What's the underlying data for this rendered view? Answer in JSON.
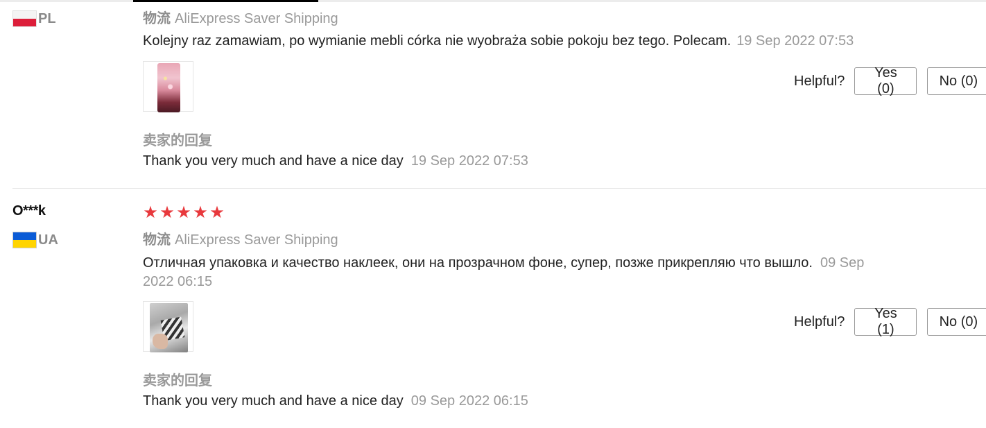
{
  "reviews": [
    {
      "username": "",
      "country_code": "PL",
      "flag": "poland-flag-icon",
      "stars": 0,
      "shipping_label": "物流",
      "shipping_method": "AliExpress Saver Shipping",
      "text": "Kolejny raz zamawiam, po wymianie mebli córka nie wyobraża sobie pokoju bez tego. Polecam.",
      "date": "19 Sep 2022 07:53",
      "helpful_label": "Helpful?",
      "yes_label": "Yes (0)",
      "no_label": "No (0)",
      "seller_reply_label": "卖家的回复",
      "reply_text": "Thank you very much and have a nice day",
      "reply_date": "19 Sep 2022 07:53"
    },
    {
      "username": "O***k",
      "country_code": "UA",
      "flag": "ukraine-flag-icon",
      "stars": 5,
      "star_symbol": "★",
      "shipping_label": "物流",
      "shipping_method": "AliExpress Saver Shipping",
      "text": "Отличная упаковка и качество наклеек, они на прозрачном фоне, супер, позже прикрепляю что вышло.",
      "date_line1": "09 Sep",
      "date_line2": "2022 06:15",
      "helpful_label": "Helpful?",
      "yes_label": "Yes (1)",
      "no_label": "No (0)",
      "seller_reply_label": "卖家的回复",
      "reply_text": "Thank you very much and have a nice day",
      "reply_date": "09 Sep 2022 06:15"
    }
  ],
  "colors": {
    "star": "#e8393d",
    "muted_text": "#999999",
    "active_tab": "#000000"
  }
}
